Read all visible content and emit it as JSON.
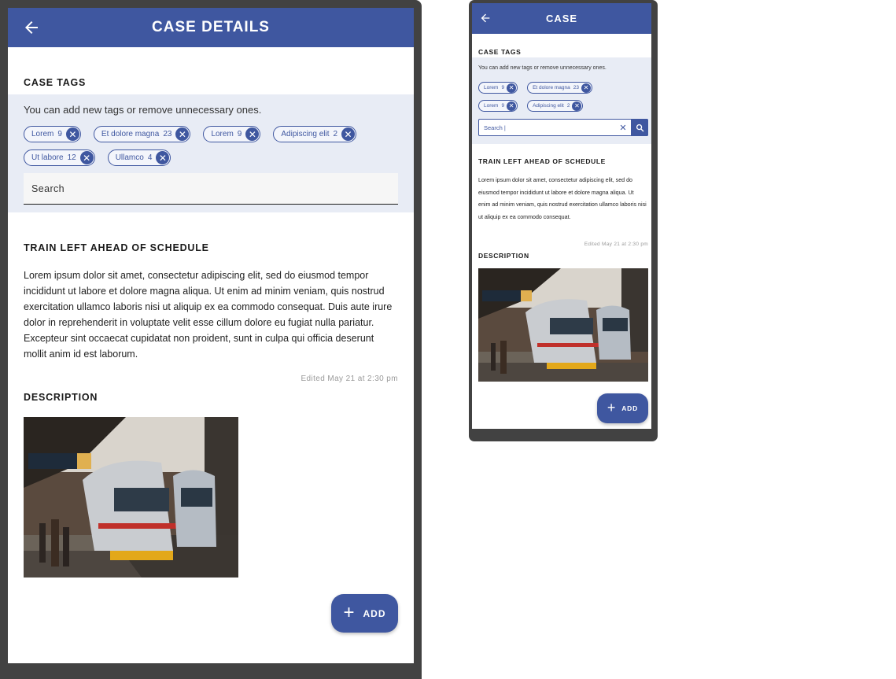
{
  "large": {
    "appbar": {
      "title": "CASE DETAILS",
      "back_icon": "arrow-left-icon"
    },
    "tags": {
      "title": "CASE TAGS",
      "hint": "You can add new tags or remove unnecessary ones.",
      "chips": [
        {
          "label": "Lorem",
          "count": "9"
        },
        {
          "label": "Et dolore magna",
          "count": "23"
        },
        {
          "label": "Lorem",
          "count": "9"
        },
        {
          "label": "Adipiscing elit",
          "count": "2"
        },
        {
          "label": "Ut labore",
          "count": "12"
        },
        {
          "label": "Ullamco",
          "count": "4"
        }
      ],
      "remove_symbol": "✕",
      "search_placeholder": "Search"
    },
    "case": {
      "title": "TRAIN LEFT AHEAD OF SCHEDULE",
      "body": "Lorem ipsum dolor sit amet, consectetur adipiscing elit, sed do eiusmod tempor incididunt ut labore et dolore magna aliqua. Ut enim ad minim veniam, quis nostrud exercitation ullamco laboris nisi ut aliquip ex ea commodo consequat. Duis aute irure dolor in reprehenderit in voluptate velit esse cillum dolore eu fugiat nulla pariatur. Excepteur sint occaecat cupidatat non proident, sunt in culpa qui officia deserunt mollit anim id est laborum.",
      "edited": "Edited May 21 at 2:30 pm"
    },
    "description": {
      "title": "DESCRIPTION",
      "photo_subject": "train-photo"
    },
    "fab": {
      "plus": "+",
      "label": "ADD"
    }
  },
  "small": {
    "appbar": {
      "title": "CASE",
      "back_icon": "arrow-left-icon"
    },
    "tags": {
      "title": "CASE TAGS",
      "hint": "You can add new tags or remove unnecessary ones.",
      "chips": [
        {
          "label": "Lorem",
          "count": "9"
        },
        {
          "label": "Et dolore magna",
          "count": "23"
        },
        {
          "label": "Lorem",
          "count": "9"
        },
        {
          "label": "Adipiscing elit",
          "count": "2"
        }
      ],
      "remove_symbol": "✕",
      "search_value": "Search |",
      "clear_symbol": "✕"
    },
    "case": {
      "title": "TRAIN LEFT AHEAD OF SCHEDULE",
      "body": "Lorem ipsum dolor sit amet, consectetur adipiscing elit, sed do eiusmod tempor incididunt ut labore et dolore magna aliqua. Ut enim ad minim veniam, quis nostrud exercitation ullamco laboris nisi ut aliquip ex ea commodo consequat.",
      "edited": "Edited May 21 at 2:30 pm"
    },
    "description": {
      "title": "DESCRIPTION",
      "photo_subject": "train-photo"
    },
    "fab": {
      "plus": "+",
      "label": "ADD"
    }
  },
  "colors": {
    "primary": "#3f57a0",
    "panel": "#e8ecf5",
    "frame": "#424242",
    "muted": "#9a9a9a"
  }
}
